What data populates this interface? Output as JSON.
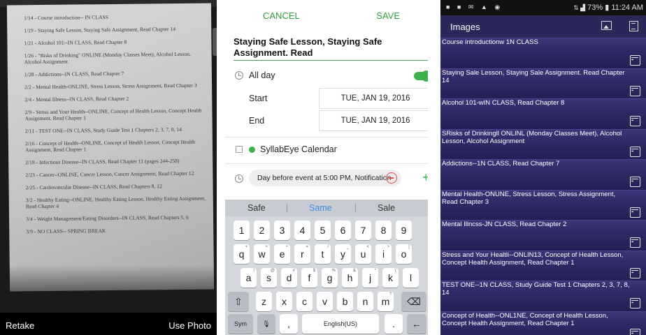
{
  "camera": {
    "lines": [
      "1/14 - Course introduction-- IN CLASS",
      "1/19 - Staying Safe Lesson, Staying Safe Assignment, Read Chapter 14",
      "1/21 - Alcohol 101--IN CLASS, Read Chapter 8",
      "1/26 - \"Risks of Drinking\" ONLINE (Monday Classes Meet), Alcohol Lesson, Alcohol Assignment",
      "1/28 - Addictions--IN CLASS, Read Chapter 7",
      "2/2 - Mental Health-ONLINE, Stress Lesson, Stress Assignment, Read Chapter 3",
      "2/4 - Mental Illness--IN CLASS, Read Chapter 2",
      "2/9 - Stress and Your Health--ONLINE, Concept of Health Lesson, Concept Health Assignment, Read Chapter 1",
      "2/11 - TEST ONE--IN CLASS, Study Guide Test 1 Chapters 2, 3, 7, 8, 14",
      "2/16 - Concept of Health--ONLINE, Concept of Health Lesson, Concept Health Assignment, Read Chapter 1",
      "2/18 - Infectious Disease--IN CLASS, Read Chapter 11 (pages 244-258)",
      "2/23 - Cancer--ONLINE, Cancer Lesson, Cancer Assignment, Read Chapter 12",
      "2/25 - Cardiovascular Disease--IN CLASS, Read Chapters 8, 12",
      "3/2 - Healthy Eating--ONLINE, Healthy Eating Lesson, Healthy Eating Assignment, Read Chapter 4",
      "3/4 - Weight Management/Eating Disorders--IN CLASS, Read Chapters 5, 6",
      "3/9 - NO CLASS-- SPRING BREAK"
    ],
    "retake": "Retake",
    "use_photo": "Use Photo"
  },
  "editor": {
    "cancel": "CANCEL",
    "save": "SAVE",
    "title": "Staying Safe Lesson, Staying Safe Assignment. Read",
    "all_day": "All day",
    "start_label": "Start",
    "start_date": "TUE, JAN 19, 2016",
    "end_label": "End",
    "end_date": "TUE, JAN 19, 2016",
    "calendar": "SyllabEye Calendar",
    "notification": "Day before event at 5:00 PM, Notification",
    "accent": "#3db24a"
  },
  "keyboard": {
    "suggestions": [
      "Safe",
      "Same",
      "Sale"
    ],
    "numbers": [
      "1",
      "2",
      "3",
      "4",
      "5",
      "6",
      "7",
      "8",
      "9"
    ],
    "row1": [
      [
        "q",
        "+"
      ],
      [
        "w",
        "×"
      ],
      [
        "e",
        "÷"
      ],
      [
        "r",
        "="
      ],
      [
        "t",
        "/"
      ],
      [
        "y",
        "_"
      ],
      [
        "u",
        "<"
      ],
      [
        "i",
        ">"
      ],
      [
        "o",
        "["
      ]
    ],
    "row2": [
      [
        "a",
        "!"
      ],
      [
        "s",
        "@"
      ],
      [
        "d",
        "#"
      ],
      [
        "f",
        "$"
      ],
      [
        "g",
        "%"
      ],
      [
        "h",
        "&"
      ],
      [
        "j",
        "*"
      ],
      [
        "k",
        "("
      ],
      [
        "l",
        ""
      ]
    ],
    "row3": [
      [
        "z",
        ""
      ],
      [
        "x",
        ""
      ],
      [
        "c",
        ""
      ],
      [
        "v",
        ""
      ],
      [
        "b",
        ""
      ],
      [
        "n",
        ""
      ],
      [
        "m",
        "?"
      ]
    ],
    "sym": "Sym",
    "comma": ",",
    "space": "English(US)",
    "period": "."
  },
  "images_app": {
    "status_time": "11:24 AM",
    "status_battery": "73%",
    "title": "Images",
    "items": [
      "Course introductionw 1N CLASS",
      "Staying Sale Lesson, Staying Sale Assignment. Read Chapter 14",
      "Alcohol 101-wIN CLASS, Read Chapter 8",
      "SRisks of Drinkingll ONLINL (Monday Classes Meet), Alcohol Lesson, Alcohol Assignment",
      "Addictions--1N CLASS, Read Chapter 7",
      "Mental Health-ONUNE, Stress Lesson, Stress Assignment, Read Chapter 3",
      "Mental Illncss-JN CLASS, Read Chapter 2",
      "Stress and Your Healtli--ONLIN13, Concept of Health Lesson, Concept Health Assignment, Read Chapter 1",
      "TEST ONE--1N CLASS, Study Guide Test 1 Chapters 2, 3, 7, 8, 14",
      "Concept of Health--ONL1NE, Concept of Health Lesson, Concept Health Assignment, Read Chapter 1"
    ],
    "bg": "#2f2b62"
  }
}
